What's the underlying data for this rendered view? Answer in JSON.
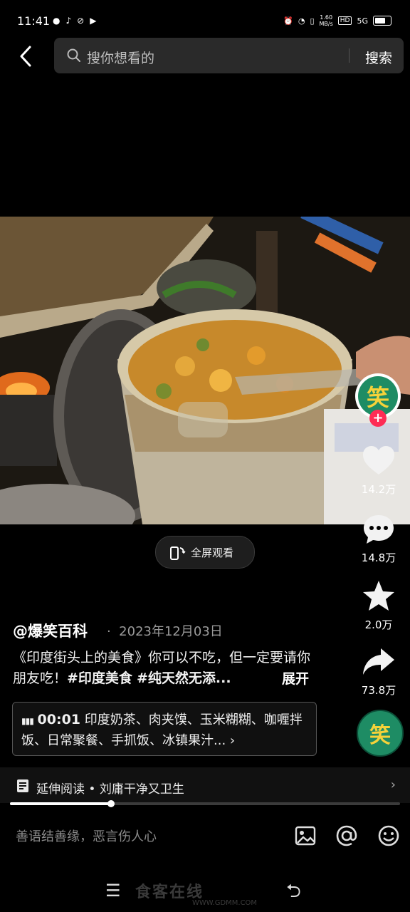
{
  "status": {
    "time": "11:41",
    "speed_value": "1.60",
    "speed_unit": "MB/s",
    "hd": "HD",
    "net": "5G"
  },
  "search": {
    "placeholder": "搜你想看的",
    "button": "搜索"
  },
  "video": {
    "fullscreen_label": "全屏观看",
    "progress": 0.26
  },
  "rail": {
    "avatar_glyph": "笑",
    "likes": "14.2万",
    "comments": "14.8万",
    "favorites": "2.0万",
    "shares": "73.8万",
    "music_glyph": "笑"
  },
  "post": {
    "author": "@爆笑百科",
    "date": "2023年12月03日",
    "caption_text": "《印度街头上的美食》你可以不吃，但一定要请你朋友吃！",
    "tag1": "#印度美食",
    "tag2": "#纯天然无添...",
    "expand": "展开"
  },
  "chapters": {
    "time": "00:01",
    "text": "印度奶茶、肉夹馍、玉米糊糊、咖喱拌饭、日常聚餐、手抓饭、冰镇果汁..."
  },
  "extended_reading": {
    "label": "延伸阅读 • 刘庸干净又卫生"
  },
  "comment_bar": {
    "placeholder": "善语结善缘，恶言伤人心"
  },
  "watermark": {
    "main": "食客在线",
    "sub": "WWW.GDMM.COM"
  },
  "colors": {
    "accent": "#fe2c55",
    "avatar_green": "#1e8c64",
    "background": "#000000"
  }
}
